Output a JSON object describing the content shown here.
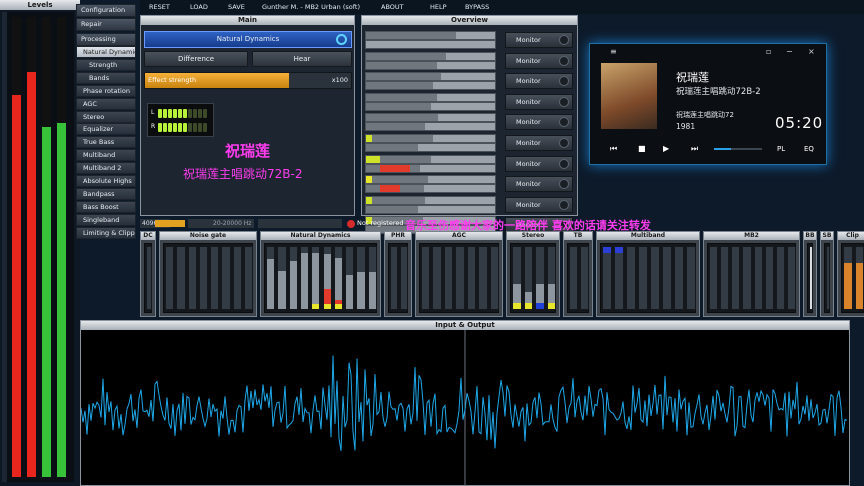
{
  "levels": {
    "title": "Levels",
    "bars": [
      {
        "color": "#e8261e",
        "level": 0.83
      },
      {
        "color": "#e8261e",
        "level": 0.88
      },
      {
        "color": "#37c23a",
        "level": 0.76
      },
      {
        "color": "#37c23a",
        "level": 0.77
      }
    ]
  },
  "menu": {
    "items": [
      "RESET",
      "LOAD",
      "SAVE",
      "Gunther M. - MB2 Urban (soft)",
      "ABOUT",
      "HELP",
      "BYPASS"
    ]
  },
  "nav": {
    "configuration": "Configuration",
    "repair": "Repair",
    "processing": "Processing",
    "items": [
      "Natural Dynamics",
      "Strength",
      "Bands",
      "Phase rotation",
      "AGC",
      "Stereo",
      "Equalizer",
      "True Bass",
      "Multiband",
      "Multiband 2",
      "Absolute Highs",
      "Bandpass",
      "Bass Boost",
      "Singleband",
      "Limiting & Clipping"
    ]
  },
  "main": {
    "title": "Main",
    "preset": "Natural Dynamics",
    "difference": "Difference",
    "hear": "Hear",
    "effect_strength": "Effect strength",
    "effect_value": "x100",
    "effect_level": 0.7,
    "meter_l": "L",
    "meter_r": "R",
    "overlay_title": "祝瑞莲",
    "overlay_subtitle": "祝瑞莲主唱跳动72B-2"
  },
  "overview": {
    "title": "Overview",
    "monitor_label": "Monitor",
    "rows": [
      {
        "a": 0.7,
        "b": 0.0
      },
      {
        "a": 0.62,
        "b": 0.55
      },
      {
        "a": 0.58,
        "b": 0.52
      },
      {
        "a": 0.55,
        "b": 0.5
      },
      {
        "a": 0.56,
        "b": 0.46
      },
      {
        "a": 0.52,
        "b": 0.4
      },
      {
        "a": 0.5,
        "b": 0.42
      },
      {
        "a": 0.48,
        "b": 0.45
      },
      {
        "a": 0.46,
        "b": 0.4
      },
      {
        "a": 0.44,
        "b": 0.38
      }
    ]
  },
  "status": {
    "buffer": "4096",
    "freq": "20-20000 Hz",
    "registered": "Not registered",
    "marquee": "音乐至伤感谢大家的一路陪伴 喜欢的话请关注转发"
  },
  "modules": {
    "labels": [
      "DC",
      "Noise gate",
      "Natural Dynamics",
      "PHR",
      "AGC",
      "Stereo",
      "TB",
      "Multiband",
      "MB2",
      "BB",
      "SB",
      "Clip"
    ]
  },
  "waveform": {
    "title": "Input & Output"
  },
  "player": {
    "title": "祝瑞莲",
    "subtitle": "祝瑞莲主唱跳动72B-2",
    "album": "祝瑞莲主唱跳动72",
    "year": "1981",
    "time": "05:20",
    "pl": "PL",
    "eq": "EQ",
    "progress": 0.35,
    "accent": "#2aa0e6"
  }
}
